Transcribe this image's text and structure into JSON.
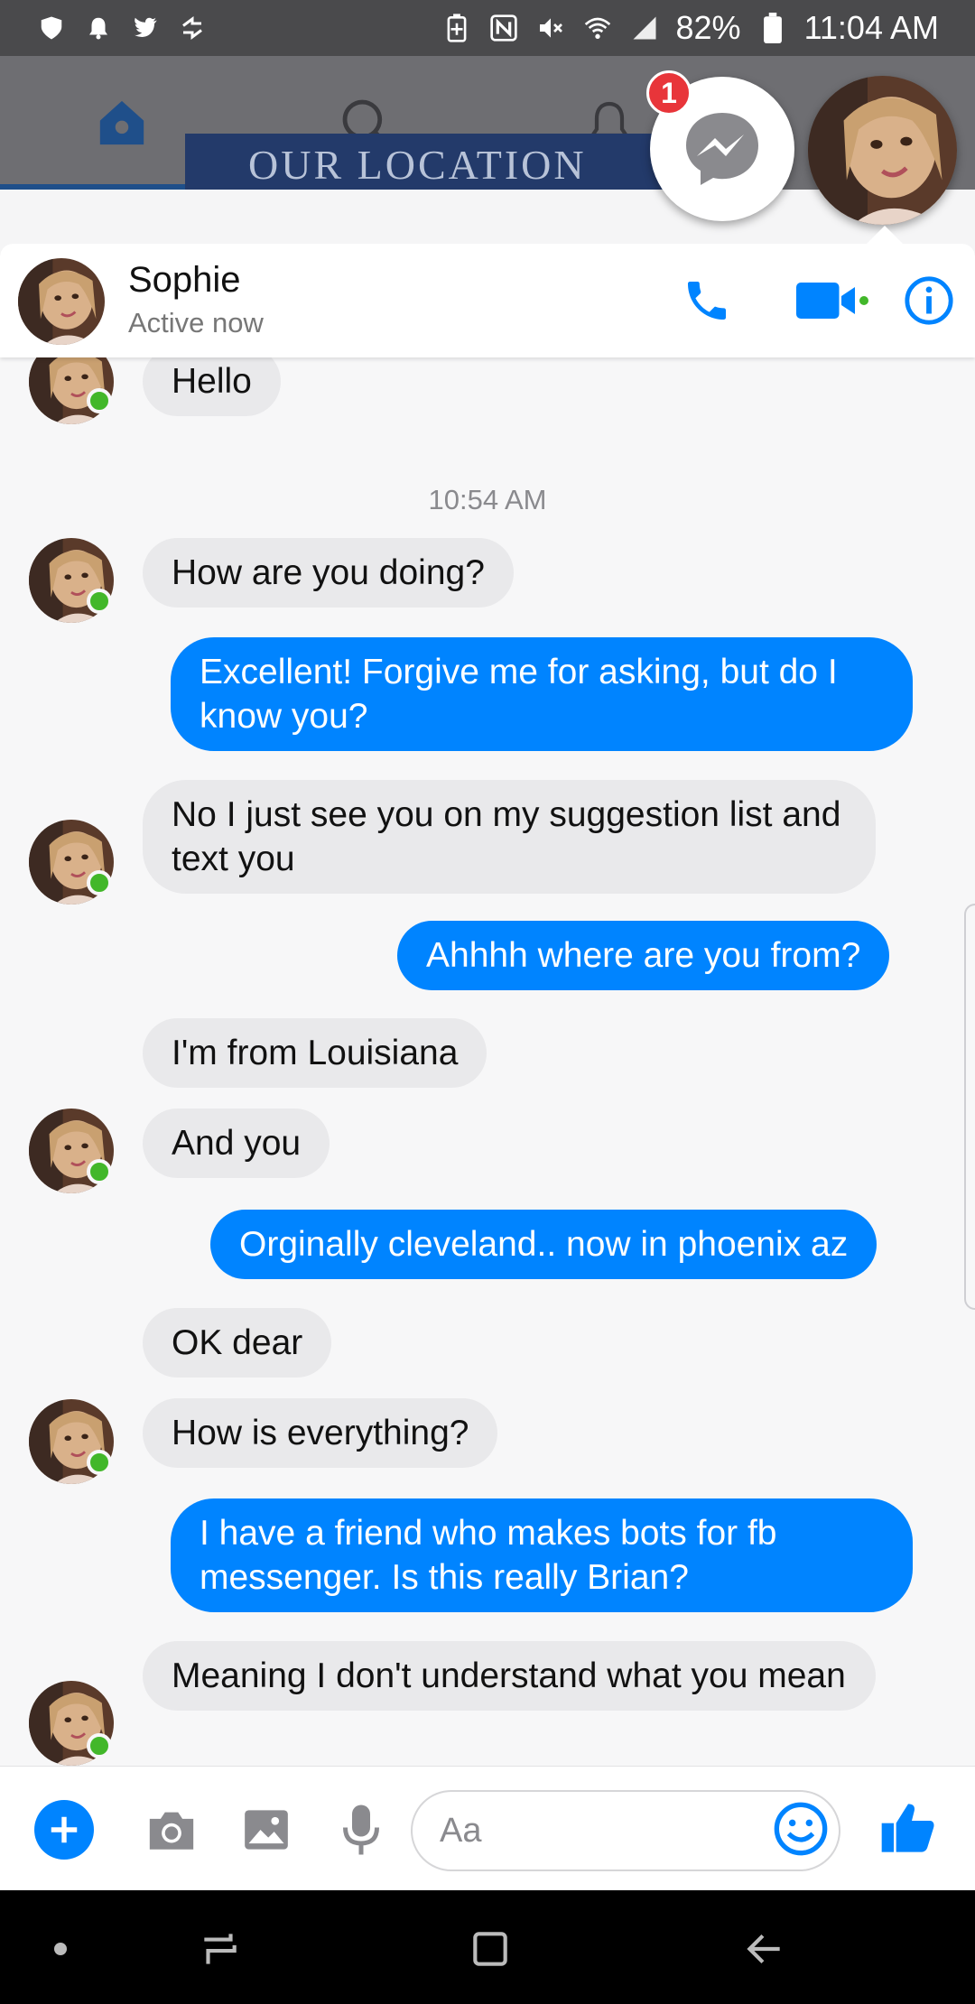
{
  "status_bar": {
    "battery": "82%",
    "time": "11:04 AM"
  },
  "fb_background": {
    "banner_text": "OUR LOCATION"
  },
  "chat_heads": {
    "badge_count": "1"
  },
  "chat_header": {
    "name": "Sophie",
    "status": "Active now"
  },
  "messages": {
    "m0": "Hello",
    "timestamp": "10:54 AM",
    "m1": "How are you doing?",
    "m2": "Excellent! Forgive me for asking, but do I know you?",
    "m3": "No I just see you on my suggestion list and text you",
    "m4": "Ahhhh where are you from?",
    "m5": "I'm from Louisiana",
    "m6": "And you",
    "m7": "Orginally cleveland.. now in phoenix az",
    "m8": "OK dear",
    "m9": "How is everything?",
    "m10": "I have a friend who makes bots for fb messenger. Is this really Brian?",
    "m11": "Meaning I don't understand what you mean"
  },
  "composer": {
    "placeholder": "Aa"
  },
  "colors": {
    "accent": "#0084ff",
    "online": "#42b72a",
    "incoming_bubble": "#e9e9eb"
  }
}
